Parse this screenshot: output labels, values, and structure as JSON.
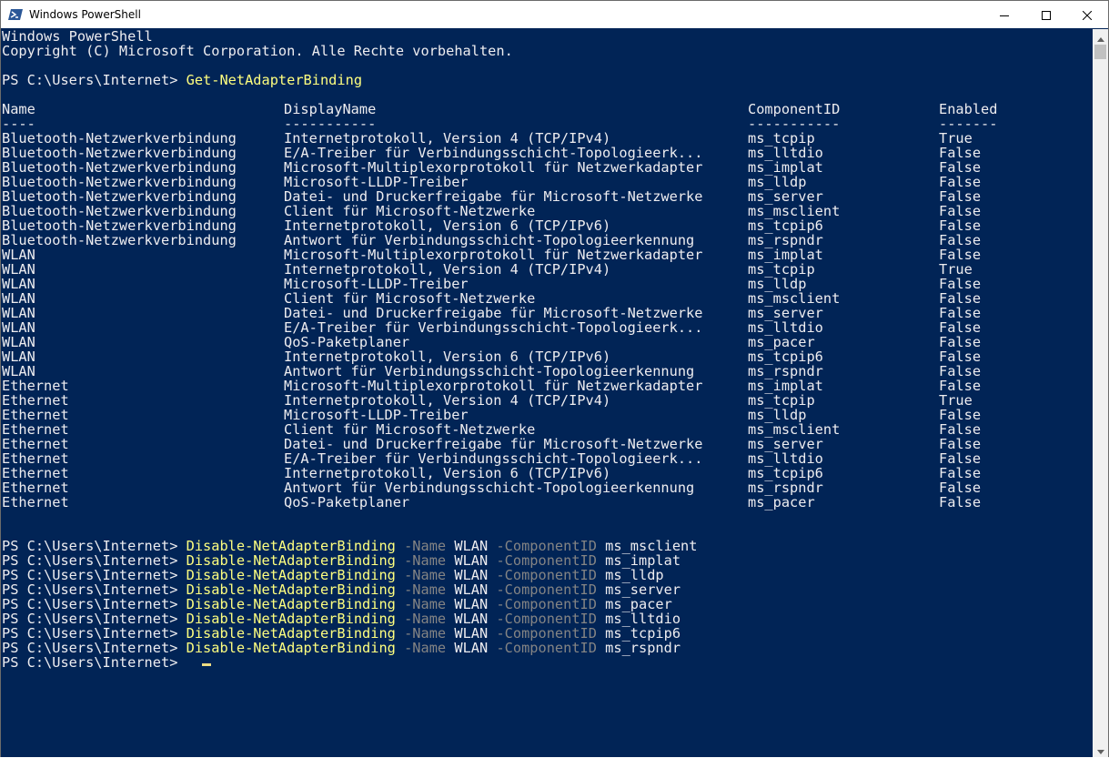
{
  "window": {
    "title": "Windows PowerShell",
    "controls": {
      "minimize_icon": "minimize-icon",
      "maximize_icon": "maximize-icon",
      "close_icon": "close-icon"
    },
    "colors": {
      "console_bg": "#012456",
      "console_fg": "#eeedf0",
      "command": "#ffff7f",
      "parameter": "#848484",
      "cursor": "#eedc82"
    }
  },
  "console": {
    "banner": [
      "Windows PowerShell",
      "Copyright (C) Microsoft Corporation. Alle Rechte vorbehalten."
    ],
    "prompt": "PS C:\\Users\\Internet>",
    "first_command": "Get-NetAdapterBinding",
    "table": {
      "headers": [
        "Name",
        "DisplayName",
        "ComponentID",
        "Enabled"
      ],
      "separators": [
        "----",
        "-----------",
        "-----------",
        "-------"
      ],
      "rows": [
        [
          "Bluetooth-Netzwerkverbindung",
          "Internetprotokoll, Version 4 (TCP/IPv4)",
          "ms_tcpip",
          "True"
        ],
        [
          "Bluetooth-Netzwerkverbindung",
          "E/A-Treiber für Verbindungsschicht-Topologieerk...",
          "ms_lltdio",
          "False"
        ],
        [
          "Bluetooth-Netzwerkverbindung",
          "Microsoft-Multiplexorprotokoll für Netzwerkadapter",
          "ms_implat",
          "False"
        ],
        [
          "Bluetooth-Netzwerkverbindung",
          "Microsoft-LLDP-Treiber",
          "ms_lldp",
          "False"
        ],
        [
          "Bluetooth-Netzwerkverbindung",
          "Datei- und Druckerfreigabe für Microsoft-Netzwerke",
          "ms_server",
          "False"
        ],
        [
          "Bluetooth-Netzwerkverbindung",
          "Client für Microsoft-Netzwerke",
          "ms_msclient",
          "False"
        ],
        [
          "Bluetooth-Netzwerkverbindung",
          "Internetprotokoll, Version 6 (TCP/IPv6)",
          "ms_tcpip6",
          "False"
        ],
        [
          "Bluetooth-Netzwerkverbindung",
          "Antwort für Verbindungsschicht-Topologieerkennung",
          "ms_rspndr",
          "False"
        ],
        [
          "WLAN",
          "Microsoft-Multiplexorprotokoll für Netzwerkadapter",
          "ms_implat",
          "False"
        ],
        [
          "WLAN",
          "Internetprotokoll, Version 4 (TCP/IPv4)",
          "ms_tcpip",
          "True"
        ],
        [
          "WLAN",
          "Microsoft-LLDP-Treiber",
          "ms_lldp",
          "False"
        ],
        [
          "WLAN",
          "Client für Microsoft-Netzwerke",
          "ms_msclient",
          "False"
        ],
        [
          "WLAN",
          "Datei- und Druckerfreigabe für Microsoft-Netzwerke",
          "ms_server",
          "False"
        ],
        [
          "WLAN",
          "E/A-Treiber für Verbindungsschicht-Topologieerk...",
          "ms_lltdio",
          "False"
        ],
        [
          "WLAN",
          "QoS-Paketplaner",
          "ms_pacer",
          "False"
        ],
        [
          "WLAN",
          "Internetprotokoll, Version 6 (TCP/IPv6)",
          "ms_tcpip6",
          "False"
        ],
        [
          "WLAN",
          "Antwort für Verbindungsschicht-Topologieerkennung",
          "ms_rspndr",
          "False"
        ],
        [
          "Ethernet",
          "Microsoft-Multiplexorprotokoll für Netzwerkadapter",
          "ms_implat",
          "False"
        ],
        [
          "Ethernet",
          "Internetprotokoll, Version 4 (TCP/IPv4)",
          "ms_tcpip",
          "True"
        ],
        [
          "Ethernet",
          "Microsoft-LLDP-Treiber",
          "ms_lldp",
          "False"
        ],
        [
          "Ethernet",
          "Client für Microsoft-Netzwerke",
          "ms_msclient",
          "False"
        ],
        [
          "Ethernet",
          "Datei- und Druckerfreigabe für Microsoft-Netzwerke",
          "ms_server",
          "False"
        ],
        [
          "Ethernet",
          "E/A-Treiber für Verbindungsschicht-Topologieerk...",
          "ms_lltdio",
          "False"
        ],
        [
          "Ethernet",
          "Internetprotokoll, Version 6 (TCP/IPv6)",
          "ms_tcpip6",
          "False"
        ],
        [
          "Ethernet",
          "Antwort für Verbindungsschicht-Topologieerkennung",
          "ms_rspndr",
          "False"
        ],
        [
          "Ethernet",
          "QoS-Paketplaner",
          "ms_pacer",
          "False"
        ]
      ]
    },
    "disable_commands": [
      {
        "cmdlet": "Disable-NetAdapterBinding",
        "param1": "-Name",
        "value1": "WLAN",
        "param2": "-ComponentID",
        "value2": "ms_msclient"
      },
      {
        "cmdlet": "Disable-NetAdapterBinding",
        "param1": "-Name",
        "value1": "WLAN",
        "param2": "-ComponentID",
        "value2": "ms_implat"
      },
      {
        "cmdlet": "Disable-NetAdapterBinding",
        "param1": "-Name",
        "value1": "WLAN",
        "param2": "-ComponentID",
        "value2": "ms_lldp"
      },
      {
        "cmdlet": "Disable-NetAdapterBinding",
        "param1": "-Name",
        "value1": "WLAN",
        "param2": "-ComponentID",
        "value2": "ms_server"
      },
      {
        "cmdlet": "Disable-NetAdapterBinding",
        "param1": "-Name",
        "value1": "WLAN",
        "param2": "-ComponentID",
        "value2": "ms_pacer"
      },
      {
        "cmdlet": "Disable-NetAdapterBinding",
        "param1": "-Name",
        "value1": "WLAN",
        "param2": "-ComponentID",
        "value2": "ms_lltdio"
      },
      {
        "cmdlet": "Disable-NetAdapterBinding",
        "param1": "-Name",
        "value1": "WLAN",
        "param2": "-ComponentID",
        "value2": "ms_tcpip6"
      },
      {
        "cmdlet": "Disable-NetAdapterBinding",
        "param1": "-Name",
        "value1": "WLAN",
        "param2": "-ComponentID",
        "value2": "ms_rspndr"
      }
    ]
  }
}
